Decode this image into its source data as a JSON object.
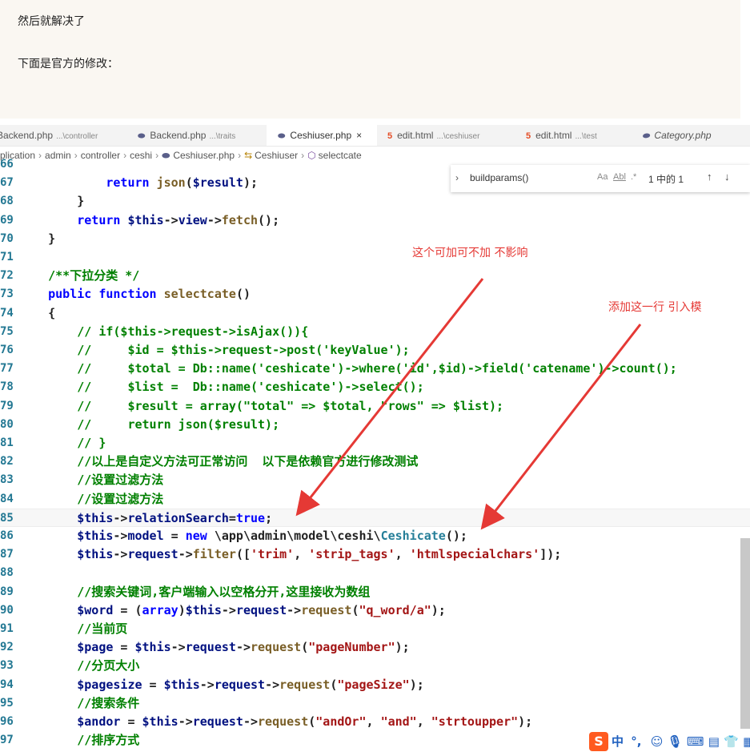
{
  "article": {
    "line1": "然后就解决了",
    "line2": "下面是官方的修改："
  },
  "tabs": [
    {
      "label": "Backend.php",
      "desc": "...\\controller",
      "icon": "php-icon",
      "active": false
    },
    {
      "label": "Backend.php",
      "desc": "...\\traits",
      "icon": "php-icon",
      "active": false
    },
    {
      "label": "Ceshiuser.php",
      "desc": "",
      "icon": "php-icon",
      "active": true,
      "close": "×"
    },
    {
      "label": "edit.html",
      "desc": "...\\ceshiuser",
      "icon": "html-icon",
      "active": false
    },
    {
      "label": "edit.html",
      "desc": "...\\test",
      "icon": "html-icon",
      "active": false
    },
    {
      "label": "Category.php",
      "desc": "",
      "icon": "php-icon",
      "active": false
    }
  ],
  "breadcrumb": {
    "items": [
      "plication",
      "admin",
      "controller",
      "ceshi",
      "Ceshiuser.php",
      "Ceshiuser",
      "selectcate"
    ]
  },
  "find": {
    "value": "buildparams()",
    "match_case": "Aa",
    "whole_word": "Abl",
    "regex": ".*",
    "count": "1 中的 1",
    "up": "↑",
    "down": "↓"
  },
  "code": [
    {
      "n": "66",
      "h": ""
    },
    {
      "n": "67",
      "h": "            <span class='k'>return</span> <span class='f'>json</span>(<span class='v'>$result</span>);"
    },
    {
      "n": "68",
      "h": "        }"
    },
    {
      "n": "69",
      "h": "        <span class='k'>return</span> <span class='v'>$this</span>-><span class='v'>view</span>-><span class='f'>fetch</span>();"
    },
    {
      "n": "70",
      "h": "    }"
    },
    {
      "n": "71",
      "h": ""
    },
    {
      "n": "72",
      "h": "    <span class='c'>/**下拉分类 */</span>"
    },
    {
      "n": "73",
      "h": "    <span class='k'>public function</span> <span class='f'>selectcate</span>()"
    },
    {
      "n": "74",
      "h": "    {"
    },
    {
      "n": "75",
      "h": "        <span class='c'>// if($this->request->isAjax()){</span>"
    },
    {
      "n": "76",
      "h": "        <span class='c'>//     $id = $this->request->post('keyValue');</span>"
    },
    {
      "n": "77",
      "h": "        <span class='c'>//     $total = Db::name('ceshicate')->where('id',$id)->field('catename')->count();</span>"
    },
    {
      "n": "78",
      "h": "        <span class='c'>//     $list =  Db::name('ceshicate')->select();</span>"
    },
    {
      "n": "79",
      "h": "        <span class='c'>//     $result = array(\"total\" => $total, \"rows\" => $list);</span>"
    },
    {
      "n": "80",
      "h": "        <span class='c'>//     return json($result);</span>"
    },
    {
      "n": "81",
      "h": "        <span class='c'>// }</span>"
    },
    {
      "n": "82",
      "h": "        <span class='c'>//以上是自定义方法可正常访问  以下是依赖官方进行修改测试</span>"
    },
    {
      "n": "83",
      "h": "        <span class='c'>//设置过滤方法</span>"
    },
    {
      "n": "84",
      "h": "        <span class='c'>//设置过滤方法</span>"
    },
    {
      "n": "85",
      "h": "        <span class='v'>$this</span>-><span class='v'>relationSearch</span>=<span class='k'>true</span>;"
    },
    {
      "n": "86",
      "h": "        <span class='v'>$this</span>-><span class='v'>model</span> = <span class='k'>new</span> \\app\\admin\\model\\ceshi\\<span class='t'>Ceshicate</span>();"
    },
    {
      "n": "87",
      "h": "        <span class='v'>$this</span>-><span class='v'>request</span>-><span class='f'>filter</span>([<span class='s2'>'trim'</span>, <span class='s2'>'strip_tags'</span>, <span class='s2'>'htmlspecialchars'</span>]);"
    },
    {
      "n": "88",
      "h": ""
    },
    {
      "n": "89",
      "h": "        <span class='c'>//搜索关键词,客户端输入以空格分开,这里接收为数组</span>"
    },
    {
      "n": "90",
      "h": "        <span class='v'>$word</span> = (<span class='k'>array</span>)<span class='v'>$this</span>-><span class='v'>request</span>-><span class='f'>request</span>(<span class='s2'>\"q_word/a\"</span>);"
    },
    {
      "n": "91",
      "h": "        <span class='c'>//当前页</span>"
    },
    {
      "n": "92",
      "h": "        <span class='v'>$page</span> = <span class='v'>$this</span>-><span class='v'>request</span>-><span class='f'>request</span>(<span class='s2'>\"pageNumber\"</span>);"
    },
    {
      "n": "93",
      "h": "        <span class='c'>//分页大小</span>"
    },
    {
      "n": "94",
      "h": "        <span class='v'>$pagesize</span> = <span class='v'>$this</span>-><span class='v'>request</span>-><span class='f'>request</span>(<span class='s2'>\"pageSize\"</span>);"
    },
    {
      "n": "95",
      "h": "        <span class='c'>//搜索条件</span>"
    },
    {
      "n": "96",
      "h": "        <span class='v'>$andor</span> = <span class='v'>$this</span>-><span class='v'>request</span>-><span class='f'>request</span>(<span class='s2'>\"andOr\"</span>, <span class='s2'>\"and\"</span>, <span class='s2'>\"strtoupper\"</span>);"
    },
    {
      "n": "97",
      "h": "        <span class='c'>//排序方式</span>"
    }
  ],
  "annotations": {
    "note1": "这个可加可不加 不影响",
    "note2": "添加这一行 引入模",
    "color": "#e53935"
  },
  "ime": {
    "logo": "S",
    "lang": "中",
    "punct": "°,",
    "icons": [
      "emoji-icon",
      "mic-icon",
      "keyboard-icon",
      "toolbox-icon",
      "shirt-icon",
      "grid-icon"
    ]
  }
}
